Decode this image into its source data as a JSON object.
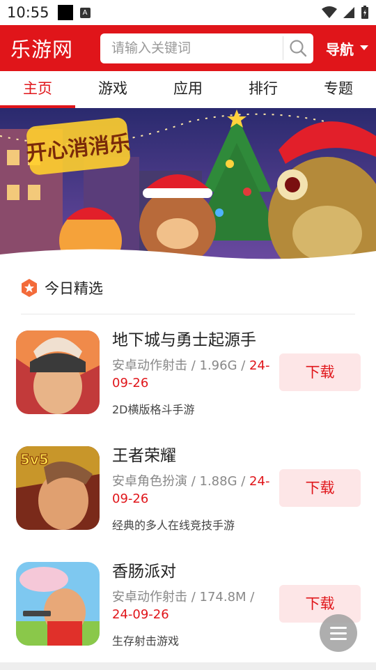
{
  "status": {
    "time": "10:55",
    "badge": "A"
  },
  "header": {
    "logo": "乐游网",
    "search_placeholder": "请输入关键词",
    "nav_label": "导航",
    "brand_color": "#e0151a"
  },
  "tabs": [
    {
      "label": "主页",
      "active": true
    },
    {
      "label": "游戏",
      "active": false
    },
    {
      "label": "应用",
      "active": false
    },
    {
      "label": "排行",
      "active": false
    },
    {
      "label": "专题",
      "active": false
    }
  ],
  "banner": {
    "title_art": "开心消消乐"
  },
  "section": {
    "title": "今日精选"
  },
  "items": [
    {
      "name": "地下城与勇士起源手",
      "meta": "安卓动作射击 / 1.96G / ",
      "date": "24-09-26",
      "desc": "2D横版格斗手游",
      "button": "下载"
    },
    {
      "name": "王者荣耀",
      "meta": "安卓角色扮演 / 1.88G / ",
      "date": "24-09-26",
      "desc": "经典的多人在线竞技手游",
      "button": "下载",
      "icon_text": "5v5"
    },
    {
      "name": "香肠派对",
      "meta": "安卓动作射击 / 174.8M / ",
      "date": "24-09-26",
      "desc": "生存射击游戏",
      "button": "下载"
    }
  ]
}
